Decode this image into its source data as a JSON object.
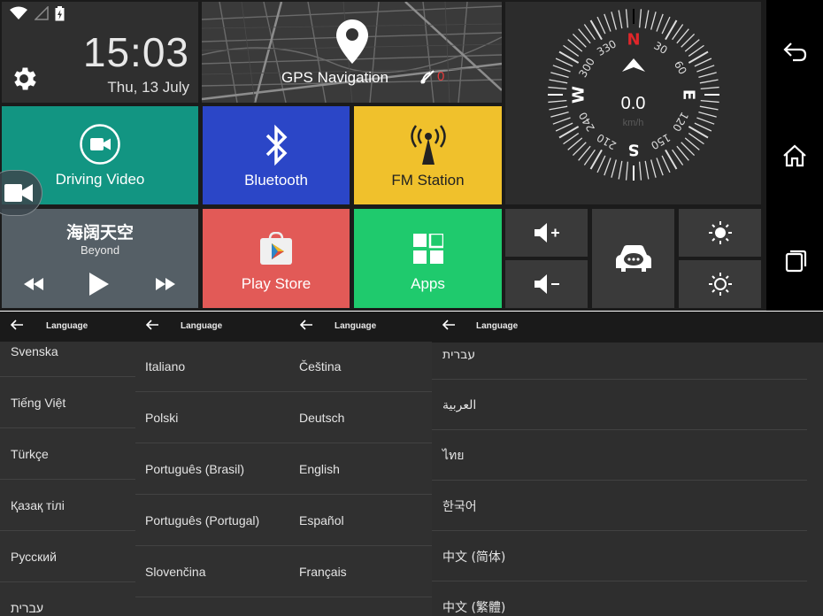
{
  "launcher": {
    "clock": {
      "time": "15:03",
      "date": "Thu, 13 July"
    },
    "gps": {
      "label": "GPS Navigation",
      "satellites": "0"
    },
    "compass": {
      "speed": "0.0",
      "unit": "km/h",
      "north": "N",
      "south": "S",
      "east": "E",
      "west": "W",
      "degrees": [
        "30",
        "60",
        "120",
        "150",
        "210",
        "240",
        "300",
        "330"
      ]
    },
    "tiles": {
      "driving_video": "Driving Video",
      "bluetooth": "Bluetooth",
      "fm_station": "FM Station",
      "play_store": "Play Store",
      "apps": "Apps"
    },
    "music": {
      "title": "海阔天空",
      "artist": "Beyond"
    },
    "colors": {
      "teal": "#129582",
      "blue": "#2b46c7",
      "yellow": "#f0c12c",
      "slate": "#555f66",
      "red": "#e25a57",
      "green": "#1fca6d",
      "north_red": "#e0262a"
    }
  },
  "panels": [
    {
      "title": "Language",
      "items": [
        "Svenska",
        "Tiếng Việt",
        "Türkçe",
        "Қазақ тілі",
        "Русский",
        "עברית"
      ]
    },
    {
      "title": "Language",
      "items": [
        "Italiano",
        "Polski",
        "Português (Brasil)",
        "Português (Portugal)",
        "Slovenčina"
      ]
    },
    {
      "title": "Language",
      "items": [
        "Čeština",
        "Deutsch",
        "English",
        "Español",
        "Français"
      ]
    },
    {
      "title": "Language",
      "items": [
        "עברית",
        "العربية",
        "ไทย",
        "한국어",
        "中文 (简体)",
        "中文 (繁體)"
      ]
    }
  ]
}
